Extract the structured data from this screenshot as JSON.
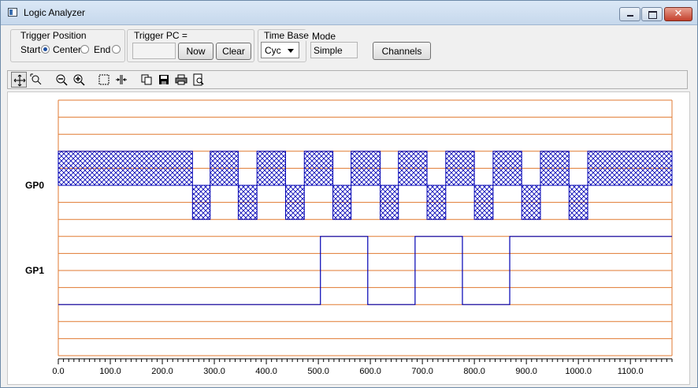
{
  "window": {
    "title": "Logic Analyzer",
    "close_glyph": "✕"
  },
  "trigger_position": {
    "label": "Trigger Position",
    "options": [
      {
        "label": "Start",
        "selected": true
      },
      {
        "label": "Center",
        "selected": false
      },
      {
        "label": "End",
        "selected": false
      }
    ]
  },
  "trigger_pc": {
    "label": "Trigger PC =",
    "value": "",
    "now_label": "Now",
    "clear_label": "Clear"
  },
  "time_base": {
    "label": "Time Base",
    "selected": "Cyc"
  },
  "mode": {
    "label": "Mode",
    "value": "Simple"
  },
  "channels_button": "Channels",
  "toolbar": {
    "icons": [
      "pan-icon",
      "zoom-region-icon",
      "zoom-out-icon",
      "zoom-in-icon",
      "select-region-icon",
      "fit-icon",
      "copy-icon",
      "save-icon",
      "print-icon",
      "print-preview-icon"
    ]
  },
  "colors": {
    "grid": "#e07a30",
    "signal": "#0000b4",
    "hatch": "#0000b4"
  },
  "chart_data": {
    "type": "timing",
    "x_range": [
      0,
      1180
    ],
    "x_ticks": [
      "0.0",
      "100.0",
      "200.0",
      "300.0",
      "400.0",
      "500.0",
      "600.0",
      "700.0",
      "800.0",
      "900.0",
      "1000.0",
      "1100.0"
    ],
    "channels": [
      {
        "name": "GP0",
        "kind": "bus",
        "segments": [
          {
            "start": 0,
            "end": 258,
            "level": "high"
          },
          {
            "start": 258,
            "end": 292,
            "level": "low"
          },
          {
            "start": 292,
            "end": 346,
            "level": "high"
          },
          {
            "start": 346,
            "end": 382,
            "level": "low"
          },
          {
            "start": 382,
            "end": 437,
            "level": "high"
          },
          {
            "start": 437,
            "end": 473,
            "level": "low"
          },
          {
            "start": 473,
            "end": 528,
            "level": "high"
          },
          {
            "start": 528,
            "end": 563,
            "level": "low"
          },
          {
            "start": 563,
            "end": 619,
            "level": "high"
          },
          {
            "start": 619,
            "end": 654,
            "level": "low"
          },
          {
            "start": 654,
            "end": 709,
            "level": "high"
          },
          {
            "start": 709,
            "end": 745,
            "level": "low"
          },
          {
            "start": 745,
            "end": 800,
            "level": "high"
          },
          {
            "start": 800,
            "end": 836,
            "level": "low"
          },
          {
            "start": 836,
            "end": 891,
            "level": "high"
          },
          {
            "start": 891,
            "end": 927,
            "level": "low"
          },
          {
            "start": 927,
            "end": 982,
            "level": "high"
          },
          {
            "start": 982,
            "end": 1018,
            "level": "low"
          },
          {
            "start": 1018,
            "end": 1180,
            "level": "high"
          }
        ]
      },
      {
        "name": "GP1",
        "kind": "bit",
        "segments": [
          {
            "start": 0,
            "end": 504,
            "level": 0
          },
          {
            "start": 504,
            "end": 595,
            "level": 1
          },
          {
            "start": 595,
            "end": 686,
            "level": 0
          },
          {
            "start": 686,
            "end": 777,
            "level": 1
          },
          {
            "start": 777,
            "end": 868,
            "level": 0
          },
          {
            "start": 868,
            "end": 1180,
            "level": 1
          }
        ]
      }
    ]
  }
}
